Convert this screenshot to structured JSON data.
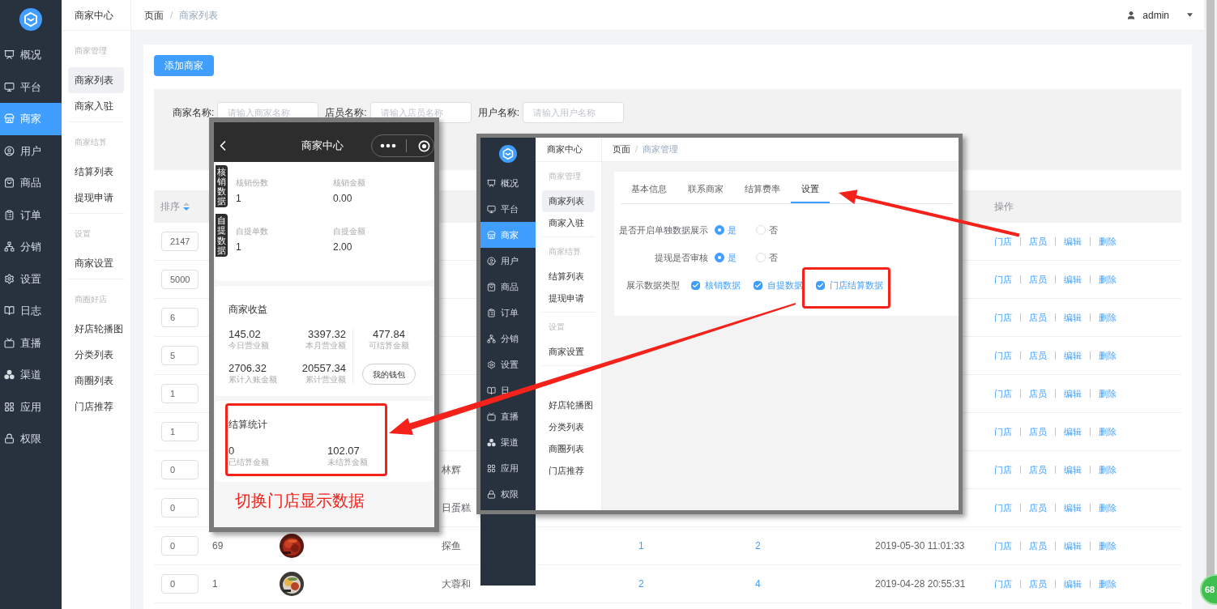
{
  "sidebar": {
    "items": [
      {
        "label": "概况",
        "selected": false
      },
      {
        "label": "平台",
        "selected": false
      },
      {
        "label": "商家",
        "selected": true
      },
      {
        "label": "用户",
        "selected": false
      },
      {
        "label": "商品",
        "selected": false
      },
      {
        "label": "订单",
        "selected": false
      },
      {
        "label": "分销",
        "selected": false
      },
      {
        "label": "设置",
        "selected": false
      },
      {
        "label": "日志",
        "selected": false
      },
      {
        "label": "直播",
        "selected": false
      },
      {
        "label": "渠道",
        "selected": false
      },
      {
        "label": "应用",
        "selected": false
      },
      {
        "label": "权限",
        "selected": false
      }
    ]
  },
  "submenu": {
    "title": "商家中心",
    "groups": [
      {
        "label": "商家管理",
        "items": [
          {
            "label": "商家列表",
            "selected": true
          },
          {
            "label": "商家入驻",
            "selected": false
          }
        ]
      },
      {
        "label": "商家结算",
        "items": [
          {
            "label": "结算列表",
            "selected": false
          },
          {
            "label": "提现申请",
            "selected": false
          }
        ]
      },
      {
        "label": "设置",
        "items": [
          {
            "label": "商家设置",
            "selected": false
          }
        ]
      },
      {
        "label": "商圈好店",
        "items": [
          {
            "label": "好店轮播图",
            "selected": false
          },
          {
            "label": "分类列表",
            "selected": false
          },
          {
            "label": "商圈列表",
            "selected": false
          },
          {
            "label": "门店推荐",
            "selected": false
          }
        ]
      }
    ]
  },
  "topbar": {
    "breadcrumb": [
      "页面",
      "商家列表"
    ],
    "separator": "/",
    "user": "admin"
  },
  "add_button": "添加商家",
  "filters": [
    {
      "label": "商家名称:",
      "placeholder": "请输入商家名称"
    },
    {
      "label": "店员名称:",
      "placeholder": "请输入店员名称"
    },
    {
      "label": "用户名称:",
      "placeholder": "请输入用户名称"
    }
  ],
  "table": {
    "columns": [
      "排序",
      "操作"
    ],
    "rows": [
      {
        "sort": "2147",
        "actions": [
          "门店",
          "店员",
          "编辑",
          "删除"
        ]
      },
      {
        "sort": "5000",
        "actions": [
          "门店",
          "店员",
          "编辑",
          "删除"
        ]
      },
      {
        "sort": "6",
        "actions": [
          "门店",
          "店员",
          "编辑",
          "删除"
        ]
      },
      {
        "sort": "5",
        "actions": [
          "门店",
          "店员",
          "编辑",
          "删除"
        ]
      },
      {
        "sort": "1",
        "actions": [
          "门店",
          "店员",
          "编辑",
          "删除"
        ]
      },
      {
        "sort": "1",
        "actions": [
          "门店",
          "店员",
          "编辑",
          "删除"
        ]
      },
      {
        "sort": "0",
        "name": "林辉",
        "actions": [
          "门店",
          "店员",
          "编辑",
          "删除"
        ]
      },
      {
        "sort": "0",
        "name": "日蛋糕",
        "actions": [
          "门店",
          "店员",
          "编辑",
          "删除"
        ]
      },
      {
        "sort": "0",
        "id": "69",
        "name": "探鱼",
        "column_5": "1",
        "column_6": "2",
        "time": "2019-05-30 11:01:33",
        "actions": [
          "门店",
          "店员",
          "编辑",
          "删除"
        ]
      },
      {
        "sort": "0",
        "id": "1",
        "name": "大蓉和",
        "column_5": "2",
        "column_6": "4",
        "time": "2019-04-28 20:55:31",
        "actions": [
          "门店",
          "店员",
          "编辑",
          "删除"
        ]
      }
    ]
  },
  "phone": {
    "title": "商家中心",
    "sections": [
      {
        "tag": "核销数据",
        "stats": [
          {
            "label": "核销份数",
            "value": "1"
          },
          {
            "label": "核销金额",
            "value": "0.00"
          }
        ]
      },
      {
        "tag": "自提数据",
        "stats": [
          {
            "label": "自提单数",
            "value": "1"
          },
          {
            "label": "自提金额",
            "value": "2.00"
          }
        ]
      }
    ],
    "income": {
      "title": "商家收益",
      "stats": [
        {
          "value": "145.02",
          "label": "今日营业额"
        },
        {
          "value": "3397.32",
          "label": "本月营业额"
        },
        {
          "value": "2706.32",
          "label": "累计入账金额"
        },
        {
          "value": "20557.34",
          "label": "累计营业额"
        }
      ],
      "settle": {
        "value": "477.84",
        "label": "可结算金额"
      },
      "wallet_button": "我的钱包"
    },
    "settlement": {
      "title": "结算统计",
      "stats": [
        {
          "value": "0",
          "label": "已结算金额"
        },
        {
          "value": "102.07",
          "label": "未结算金额"
        }
      ]
    },
    "caption": "切换门店显示数据"
  },
  "admin_overlay": {
    "sidebar": {
      "items": [
        {
          "label": "概况",
          "selected": false
        },
        {
          "label": "平台",
          "selected": false
        },
        {
          "label": "商家",
          "selected": true
        },
        {
          "label": "用户",
          "selected": false
        },
        {
          "label": "商品",
          "selected": false
        },
        {
          "label": "订单",
          "selected": false
        },
        {
          "label": "分销",
          "selected": false
        },
        {
          "label": "设置",
          "selected": false
        },
        {
          "label": "日",
          "selected": false
        },
        {
          "label": "直播",
          "selected": false
        },
        {
          "label": "渠道",
          "selected": false
        },
        {
          "label": "应用",
          "selected": false
        },
        {
          "label": "权限",
          "selected": false
        }
      ]
    },
    "submenu": {
      "title": "商家中心",
      "groups": [
        {
          "label": "商家管理",
          "items": [
            {
              "label": "商家列表",
              "selected": true
            },
            {
              "label": "商家入驻",
              "selected": false
            }
          ]
        },
        {
          "label": "商家结算",
          "items": [
            {
              "label": "结算列表",
              "selected": false
            },
            {
              "label": "提现申请",
              "selected": false
            }
          ]
        },
        {
          "label": "设置",
          "items": [
            {
              "label": "商家设置",
              "selected": false
            }
          ]
        },
        {
          "items": [
            {
              "label": "好店轮播图",
              "selected": false
            },
            {
              "label": "分类列表",
              "selected": false
            },
            {
              "label": "商圈列表",
              "selected": false
            },
            {
              "label": "门店推荐",
              "selected": false
            }
          ]
        }
      ]
    },
    "breadcrumb": [
      "页面",
      "商家管理"
    ],
    "separator": "/",
    "tabs": [
      {
        "label": "基本信息",
        "selected": false
      },
      {
        "label": "联系商家",
        "selected": false
      },
      {
        "label": "结算费率",
        "selected": false
      },
      {
        "label": "设置",
        "selected": true
      }
    ],
    "form": [
      {
        "kind": "radio",
        "label": "是否开启单独数据展示",
        "options": [
          {
            "label": "是",
            "selected": true
          },
          {
            "label": "否",
            "selected": false
          }
        ]
      },
      {
        "kind": "radio",
        "label": "提现是否审核",
        "options": [
          {
            "label": "是",
            "selected": true
          },
          {
            "label": "否",
            "selected": false
          }
        ]
      },
      {
        "kind": "checkbox",
        "label": "展示数据类型",
        "options": [
          {
            "label": "核销数据",
            "checked": true
          },
          {
            "label": "自提数据",
            "checked": true
          },
          {
            "label": "门店结算数据",
            "checked": true
          }
        ]
      }
    ]
  },
  "badge": "68"
}
